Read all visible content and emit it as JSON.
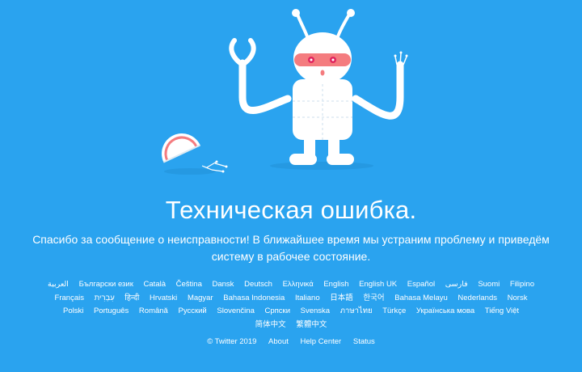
{
  "error": {
    "title": "Техническая ошибка.",
    "message_line1": "Спасибо за сообщение о неисправности! В ближайшее время мы устраним проблему и приведём",
    "message_line2": "систему в рабочее состояние."
  },
  "languages": {
    "row1": [
      "العربية",
      "Български език",
      "Català",
      "Čeština",
      "Dansk",
      "Deutsch",
      "Ελληνικά",
      "English",
      "English UK",
      "Español",
      "فارسی",
      "Suomi",
      "Filipino"
    ],
    "row2": [
      "Français",
      "עִבְרִית",
      "हिन्दी",
      "Hrvatski",
      "Magyar",
      "Bahasa Indonesia",
      "Italiano",
      "日本語",
      "한국어",
      "Bahasa Melayu",
      "Nederlands",
      "Norsk"
    ],
    "row3": [
      "Polski",
      "Português",
      "Română",
      "Русский",
      "Slovenčina",
      "Српски",
      "Svenska",
      "ภาษาไทย",
      "Türkçe",
      "Українська мова",
      "Tiếng Việt"
    ],
    "row4": [
      "简体中文",
      "繁體中文"
    ]
  },
  "footer": {
    "copyright": "© Twitter 2019",
    "about": "About",
    "help_center": "Help Center",
    "status": "Status"
  },
  "colors": {
    "background": "#2AA3EF",
    "robot_body": "#FFFFFF",
    "robot_visor": "#F47C7F",
    "robot_eyes": "#E0245E"
  },
  "icons": {
    "illustration": "broken-robot-illustration"
  }
}
